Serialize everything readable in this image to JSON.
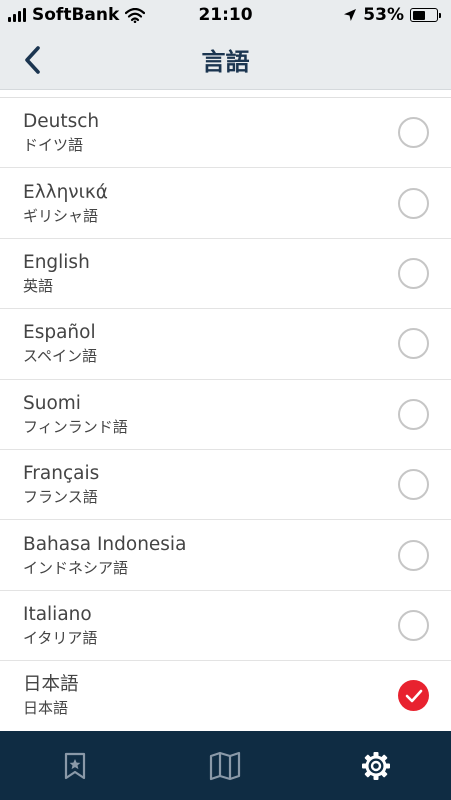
{
  "status_bar": {
    "carrier": "SoftBank",
    "time": "21:10",
    "battery_percent": "53%",
    "battery_level": 0.53
  },
  "nav": {
    "title": "言語",
    "back_icon": "chevron-left-icon"
  },
  "languages": [
    {
      "name": "Deutsch",
      "subtitle": "ドイツ語",
      "selected": false
    },
    {
      "name": "Ελληνικά",
      "subtitle": "ギリシャ語",
      "selected": false
    },
    {
      "name": "English",
      "subtitle": "英語",
      "selected": false
    },
    {
      "name": "Español",
      "subtitle": "スペイン語",
      "selected": false
    },
    {
      "name": "Suomi",
      "subtitle": "フィンランド語",
      "selected": false
    },
    {
      "name": "Français",
      "subtitle": "フランス語",
      "selected": false
    },
    {
      "name": "Bahasa Indonesia",
      "subtitle": "インドネシア語",
      "selected": false
    },
    {
      "name": "Italiano",
      "subtitle": "イタリア語",
      "selected": false
    },
    {
      "name": "日本語",
      "subtitle": "日本語",
      "selected": true
    }
  ],
  "tabs": [
    {
      "icon": "bookmark-star-icon",
      "active": false
    },
    {
      "icon": "map-icon",
      "active": false
    },
    {
      "icon": "gear-icon",
      "active": true
    }
  ],
  "colors": {
    "accent_red": "#e8222f",
    "nav_title": "#1b3550",
    "tab_bar_bg": "#0f2c43",
    "tab_inactive": "#8a99a8",
    "tab_active": "#ffffff"
  }
}
